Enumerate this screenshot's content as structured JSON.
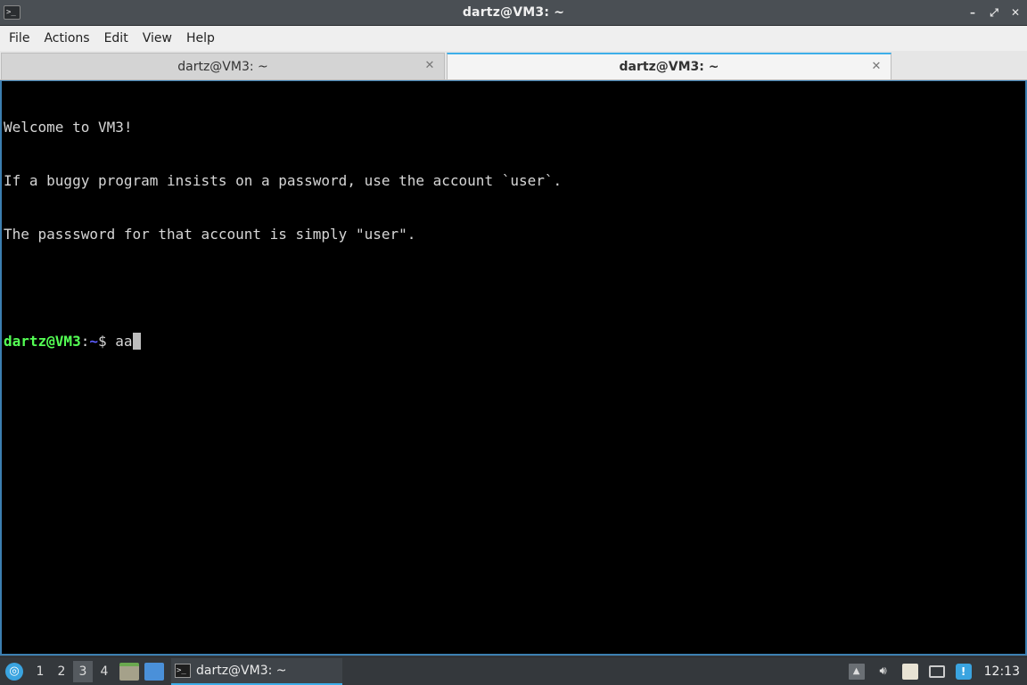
{
  "window": {
    "title": "dartz@VM3: ~",
    "app_icon_glyph": ">_",
    "buttons": {
      "minimize": "–",
      "maximize": "⤢",
      "close": "✕"
    }
  },
  "menubar": {
    "items": [
      "File",
      "Actions",
      "Edit",
      "View",
      "Help"
    ]
  },
  "tabs": [
    {
      "label": "dartz@VM3: ~",
      "active": false
    },
    {
      "label": "dartz@VM3: ~",
      "active": true
    }
  ],
  "tab_close_glyph": "✕",
  "terminal": {
    "lines": [
      "Welcome to VM3!",
      "If a buggy program insists on a password, use the account `user`.",
      "The passsword for that account is simply \"user\".",
      ""
    ],
    "prompt": {
      "user_host": "dartz@VM3",
      "separator": ":",
      "path": "~",
      "symbol": "$ ",
      "input": "aa"
    },
    "colors": {
      "background": "#000000",
      "text": "#d6d6d6",
      "user_host": "#54ff54",
      "path": "#5c5cff"
    }
  },
  "taskbar": {
    "start_icon": "lubuntu-start-icon",
    "desktops": [
      "1",
      "2",
      "3",
      "4"
    ],
    "current_desktop": "3",
    "quick_launch": [
      "file-manager-icon",
      "show-desktop-icon"
    ],
    "task": {
      "label": "dartz@VM3: ~",
      "icon": "terminal-icon"
    },
    "tray": {
      "icons": [
        "tray-expand-icon",
        "volume-icon",
        "clipboard-icon",
        "network-icon",
        "update-notifier-icon"
      ],
      "clock": "12:13"
    },
    "accent": "#3daee9"
  }
}
